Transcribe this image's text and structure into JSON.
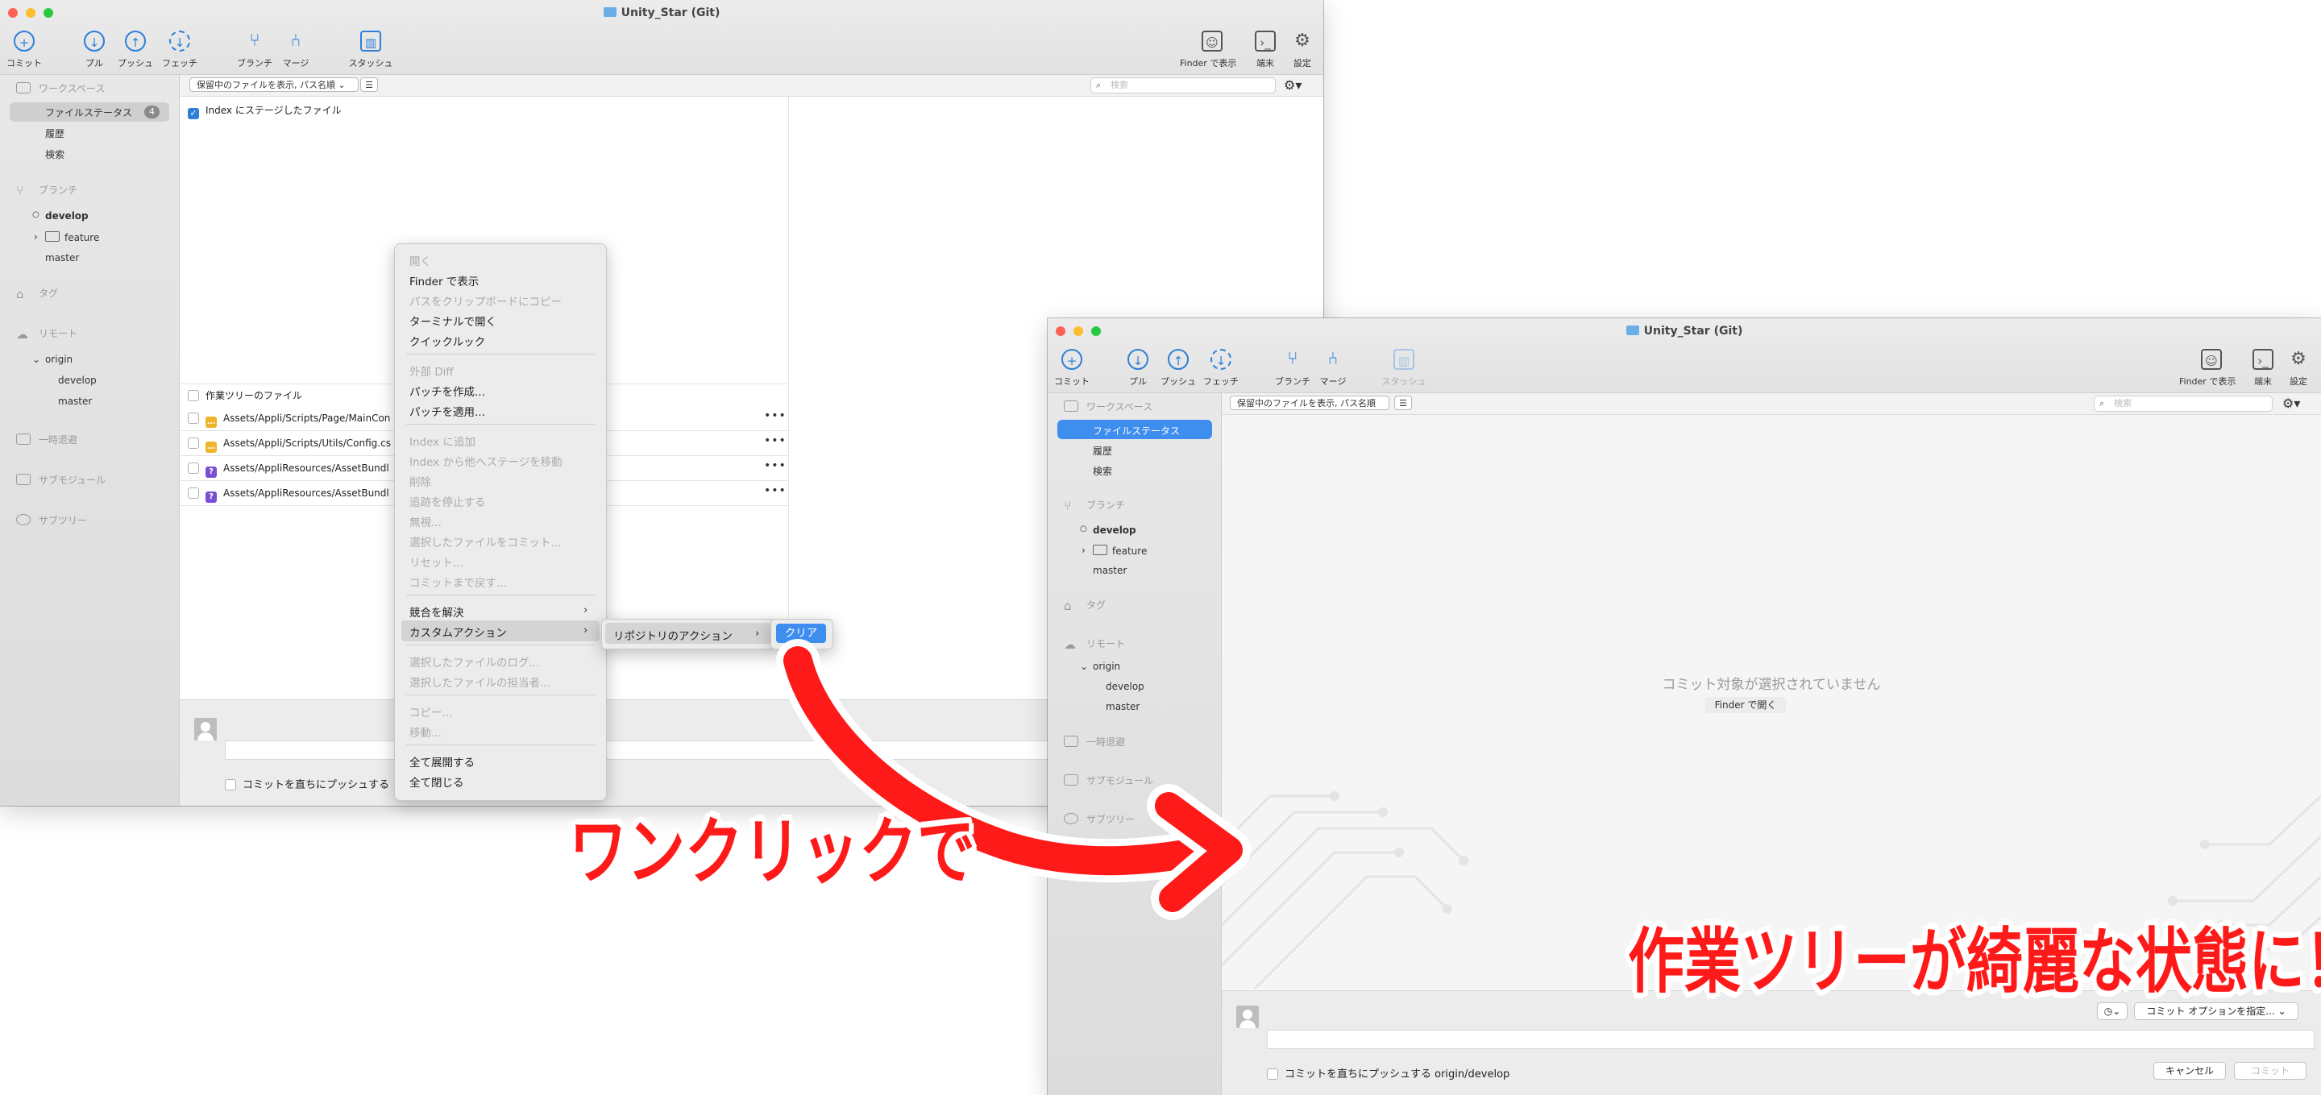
{
  "win1": {
    "title": "Unity_Star (Git)",
    "toolbar": {
      "commit": "コミット",
      "pull": "プル",
      "push": "プッシュ",
      "fetch": "フェッチ",
      "branch": "ブランチ",
      "merge": "マージ",
      "stash": "スタッシュ",
      "finder": "Finder で表示",
      "terminal": "端末",
      "settings": "設定"
    },
    "sidebar": {
      "workspace": "ワークスペース",
      "file_status": "ファイルステータス",
      "file_status_badge": "4",
      "history": "履歴",
      "search": "検索",
      "branches": "ブランチ",
      "develop": "develop",
      "feature": "feature",
      "master": "master",
      "tags": "タグ",
      "remotes": "リモート",
      "origin": "origin",
      "origin_develop": "develop",
      "origin_master": "master",
      "stashes": "一時退避",
      "submodules": "サブモジュール",
      "subtrees": "サブツリー"
    },
    "filter": {
      "dropdown": "保留中のファイルを表示, パス名順",
      "search_placeholder": "検索"
    },
    "staged_header": "Index にステージしたファイル",
    "unstaged_header": "作業ツリーのファイル",
    "files": [
      {
        "path": "Assets/Appli/Scripts/Page/MainCon",
        "status": "modified"
      },
      {
        "path": "Assets/Appli/Scripts/Utils/Config.cs",
        "status": "modified"
      },
      {
        "path": "Assets/AppliResources/AssetBundl",
        "status": "untracked"
      },
      {
        "path": "Assets/AppliResources/AssetBundl",
        "status": "untracked"
      }
    ],
    "push_checkbox": "コミットを直ちにプッシュする"
  },
  "context_menu": {
    "items": [
      {
        "label": "開く",
        "disabled": true
      },
      {
        "label": "Finder で表示",
        "disabled": false
      },
      {
        "label": "パスをクリップボードにコピー",
        "disabled": true
      },
      {
        "label": "ターミナルで開く",
        "disabled": false
      },
      {
        "label": "クイックルック",
        "disabled": false
      },
      {
        "label": "外部 Diff",
        "disabled": true
      },
      {
        "label": "パッチを作成...",
        "disabled": false
      },
      {
        "label": "パッチを適用...",
        "disabled": false
      },
      {
        "label": "Index に追加",
        "disabled": true
      },
      {
        "label": "Index から他へステージを移動",
        "disabled": true
      },
      {
        "label": "削除",
        "disabled": true
      },
      {
        "label": "追跡を停止する",
        "disabled": true
      },
      {
        "label": "無視...",
        "disabled": true
      },
      {
        "label": "選択したファイルをコミット...",
        "disabled": true
      },
      {
        "label": "リセット...",
        "disabled": true
      },
      {
        "label": "コミットまで戻す...",
        "disabled": true
      },
      {
        "label": "競合を解決",
        "disabled": false
      },
      {
        "label": "カスタムアクション",
        "disabled": false
      },
      {
        "label": "選択したファイルのログ...",
        "disabled": true
      },
      {
        "label": "選択したファイルの担当者...",
        "disabled": true
      },
      {
        "label": "コピー...",
        "disabled": true
      },
      {
        "label": "移動...",
        "disabled": true
      },
      {
        "label": "全て展開する",
        "disabled": false
      },
      {
        "label": "全て閉じる",
        "disabled": false
      }
    ],
    "submenu1": "リポジトリのアクション",
    "submenu2": "クリア"
  },
  "win2": {
    "title": "Unity_Star (Git)",
    "toolbar": {
      "commit": "コミット",
      "pull": "プル",
      "push": "プッシュ",
      "fetch": "フェッチ",
      "branch": "ブランチ",
      "merge": "マージ",
      "stash": "スタッシュ",
      "finder": "Finder で表示",
      "terminal": "端末",
      "settings": "設定"
    },
    "sidebar": {
      "workspace": "ワークスペース",
      "file_status": "ファイルステータス",
      "history": "履歴",
      "search": "検索",
      "branches": "ブランチ",
      "develop": "develop",
      "feature": "feature",
      "master": "master",
      "tags": "タグ",
      "remotes": "リモート",
      "origin": "origin",
      "origin_develop": "develop",
      "origin_master": "master",
      "stashes": "一時退避",
      "submodules": "サブモジュール",
      "subtrees": "サブツリー"
    },
    "filter": {
      "dropdown": "保留中のファイルを表示, パス名順",
      "search_placeholder": "検索"
    },
    "empty_message": "コミット対象が選択されていません",
    "open_in_finder": "Finder で開く",
    "commit_options": "コミット オプションを指定...",
    "push_checkbox": "コミットを直ちにプッシュする origin/develop",
    "cancel": "キャンセル",
    "commit_button": "コミット"
  },
  "captions": {
    "one_click": "ワンクリックで",
    "result": "作業ツリーが綺麗な状態に！"
  },
  "colors": {
    "accent": "#3e8ef0",
    "caption_red": "#ff1a1a"
  }
}
